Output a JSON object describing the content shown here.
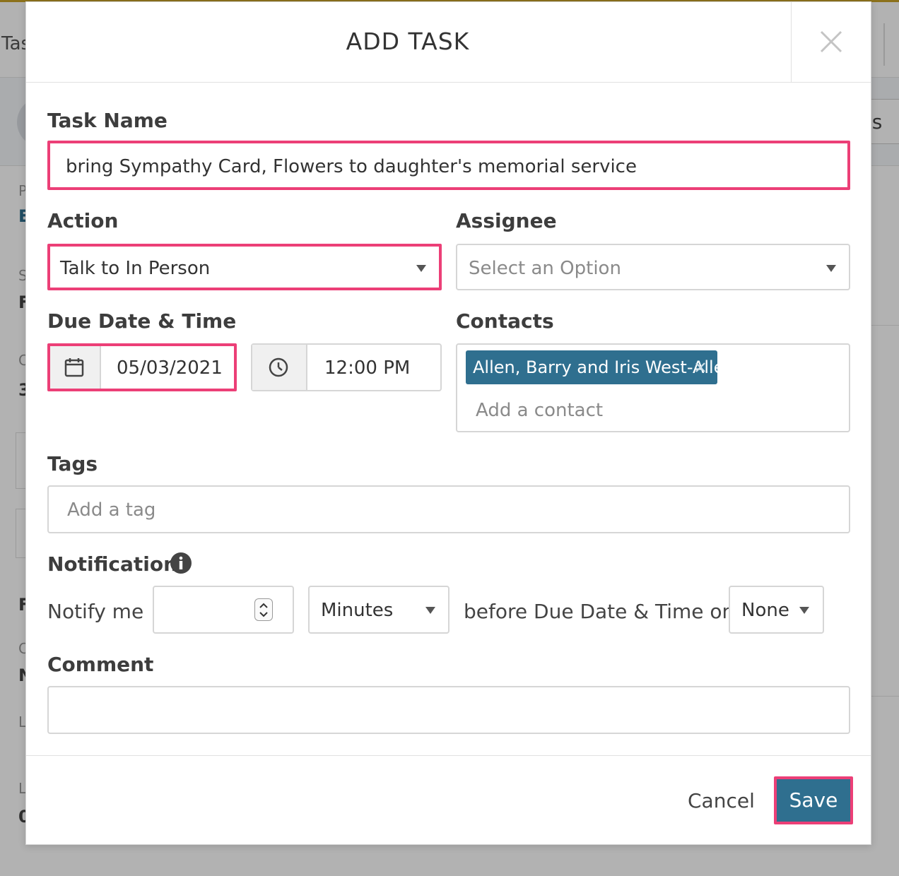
{
  "background": {
    "tab_fragment": "Tas",
    "right_fragment": "ls",
    "side_letters": [
      "P",
      "E",
      "S",
      "F",
      "C",
      "3",
      "F",
      "C",
      "N",
      "L",
      "L",
      "0"
    ]
  },
  "modal": {
    "title": "ADD TASK",
    "close_icon": "close-icon"
  },
  "form": {
    "task_name": {
      "label": "Task Name",
      "value": "bring Sympathy Card, Flowers to daughter's memorial service"
    },
    "action": {
      "label": "Action",
      "value": "Talk to In Person"
    },
    "assignee": {
      "label": "Assignee",
      "placeholder": "Select an Option"
    },
    "due": {
      "label": "Due Date & Time",
      "date": "05/03/2021",
      "time": "12:00 PM",
      "date_icon": "calendar-icon",
      "time_icon": "clock-icon"
    },
    "contacts": {
      "label": "Contacts",
      "chips": [
        "Allen, Barry and Iris West-Allen"
      ],
      "placeholder": "Add a contact"
    },
    "tags": {
      "label": "Tags",
      "placeholder": "Add a tag"
    },
    "notification": {
      "label": "Notification",
      "info_icon": "info-icon",
      "notify_me": "Notify me",
      "amount": "",
      "unit": "Minutes",
      "before_text": "before Due Date & Time on",
      "channel": "None"
    },
    "comment": {
      "label": "Comment",
      "value": ""
    }
  },
  "footer": {
    "cancel_label": "Cancel",
    "save_label": "Save"
  },
  "colors": {
    "accent": "#2f6f8f",
    "highlight": "#ec3f77"
  }
}
